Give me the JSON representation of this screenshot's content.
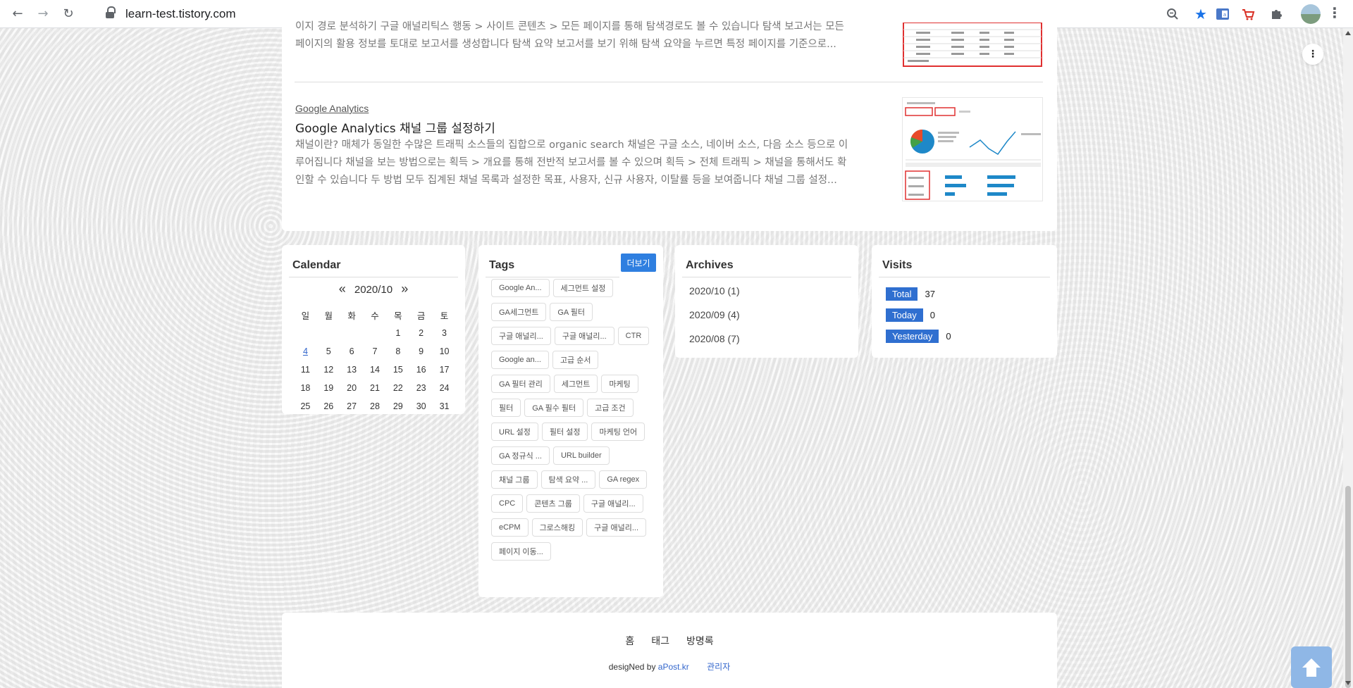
{
  "browser": {
    "url": "learn-test.tistory.com"
  },
  "post": {
    "prev_excerpt_line1": "이지 경로 분석하기 구글 애널리틱스 행동 > 사이트 콘텐츠 > 모든 페이지를 통해 탐색경로도 볼 수 있습니다 탐색 보고서는 모든",
    "prev_excerpt_line2": "페이지의 활용 정보를 토대로 보고서를 생성합니다 탐색 요약 보고서를 보기 위해 탐색 요약을 누르면 특정 페이지를 기준으로...",
    "category": "Google Analytics",
    "title": "Google Analytics 채널 그룹 설정하기",
    "excerpt_line1": "채널이란? 매체가 동일한 수많은 트래픽 소스들의 집합으로 organic search 채널은 구글 소스, 네이버 소스, 다음 소스 등으로 이",
    "excerpt_line2": "루어집니다 채널을 보는 방법으로는 획득 > 개요를 통해 전반적 보고서를 볼 수 있으며 획득 > 전체 트래픽 > 채널을 통해서도 확",
    "excerpt_line3": "인할 수 있습니다 두 방법 모두 집계된 채널 목록과 설정한 목표, 사용자, 신규 사용자, 이탈률 등을 보여줍니다 채널 그룹 설정..."
  },
  "calendar": {
    "title": "Calendar",
    "prev": "«",
    "month": "2020/10",
    "next": "»",
    "weekdays": [
      "일",
      "월",
      "화",
      "수",
      "목",
      "금",
      "토"
    ],
    "weeks": [
      [
        "",
        "",
        "",
        "",
        "1",
        "2",
        "3"
      ],
      [
        "4",
        "5",
        "6",
        "7",
        "8",
        "9",
        "10"
      ],
      [
        "11",
        "12",
        "13",
        "14",
        "15",
        "16",
        "17"
      ],
      [
        "18",
        "19",
        "20",
        "21",
        "22",
        "23",
        "24"
      ],
      [
        "25",
        "26",
        "27",
        "28",
        "29",
        "30",
        "31"
      ]
    ]
  },
  "tags": {
    "title": "Tags",
    "more_label": "더보기",
    "items": [
      "Google An...",
      "세그먼트 설정",
      "GA세그먼트",
      "GA 필터",
      "구글 애널리...",
      "구글 애널리...",
      "CTR",
      "Google an...",
      "고급 순서",
      "GA 필터 관리",
      "세그먼트",
      "마케팅",
      "필터",
      "GA 필수 필터",
      "고급 조건",
      "URL 설정",
      "필터 설정",
      "마케팅 언어",
      "GA 정규식 ...",
      "URL builder",
      "채널 그룹",
      "탐색 요약 ...",
      "GA regex",
      "CPC",
      "콘텐츠 그룹",
      "구글 애널리...",
      "eCPM",
      "그로스해킹",
      "구글 애널리...",
      "페이지 이동..."
    ]
  },
  "archives": {
    "title": "Archives",
    "items": [
      "2020/10 (1)",
      "2020/09 (4)",
      "2020/08 (7)"
    ]
  },
  "visits": {
    "title": "Visits",
    "total_label": "Total",
    "total_value": "37",
    "today_label": "Today",
    "today_value": "0",
    "yesterday_label": "Yesterday",
    "yesterday_value": "0"
  },
  "footer": {
    "nav": [
      "홈",
      "태그",
      "방명록"
    ],
    "credit_prefix": "desigNed by ",
    "credit_link": "aPost.kr",
    "admin_link": "관리자"
  },
  "colors": {
    "accent": "#2f7fe0",
    "visit_badge": "#2f6fd0",
    "link": "#3366cc"
  }
}
